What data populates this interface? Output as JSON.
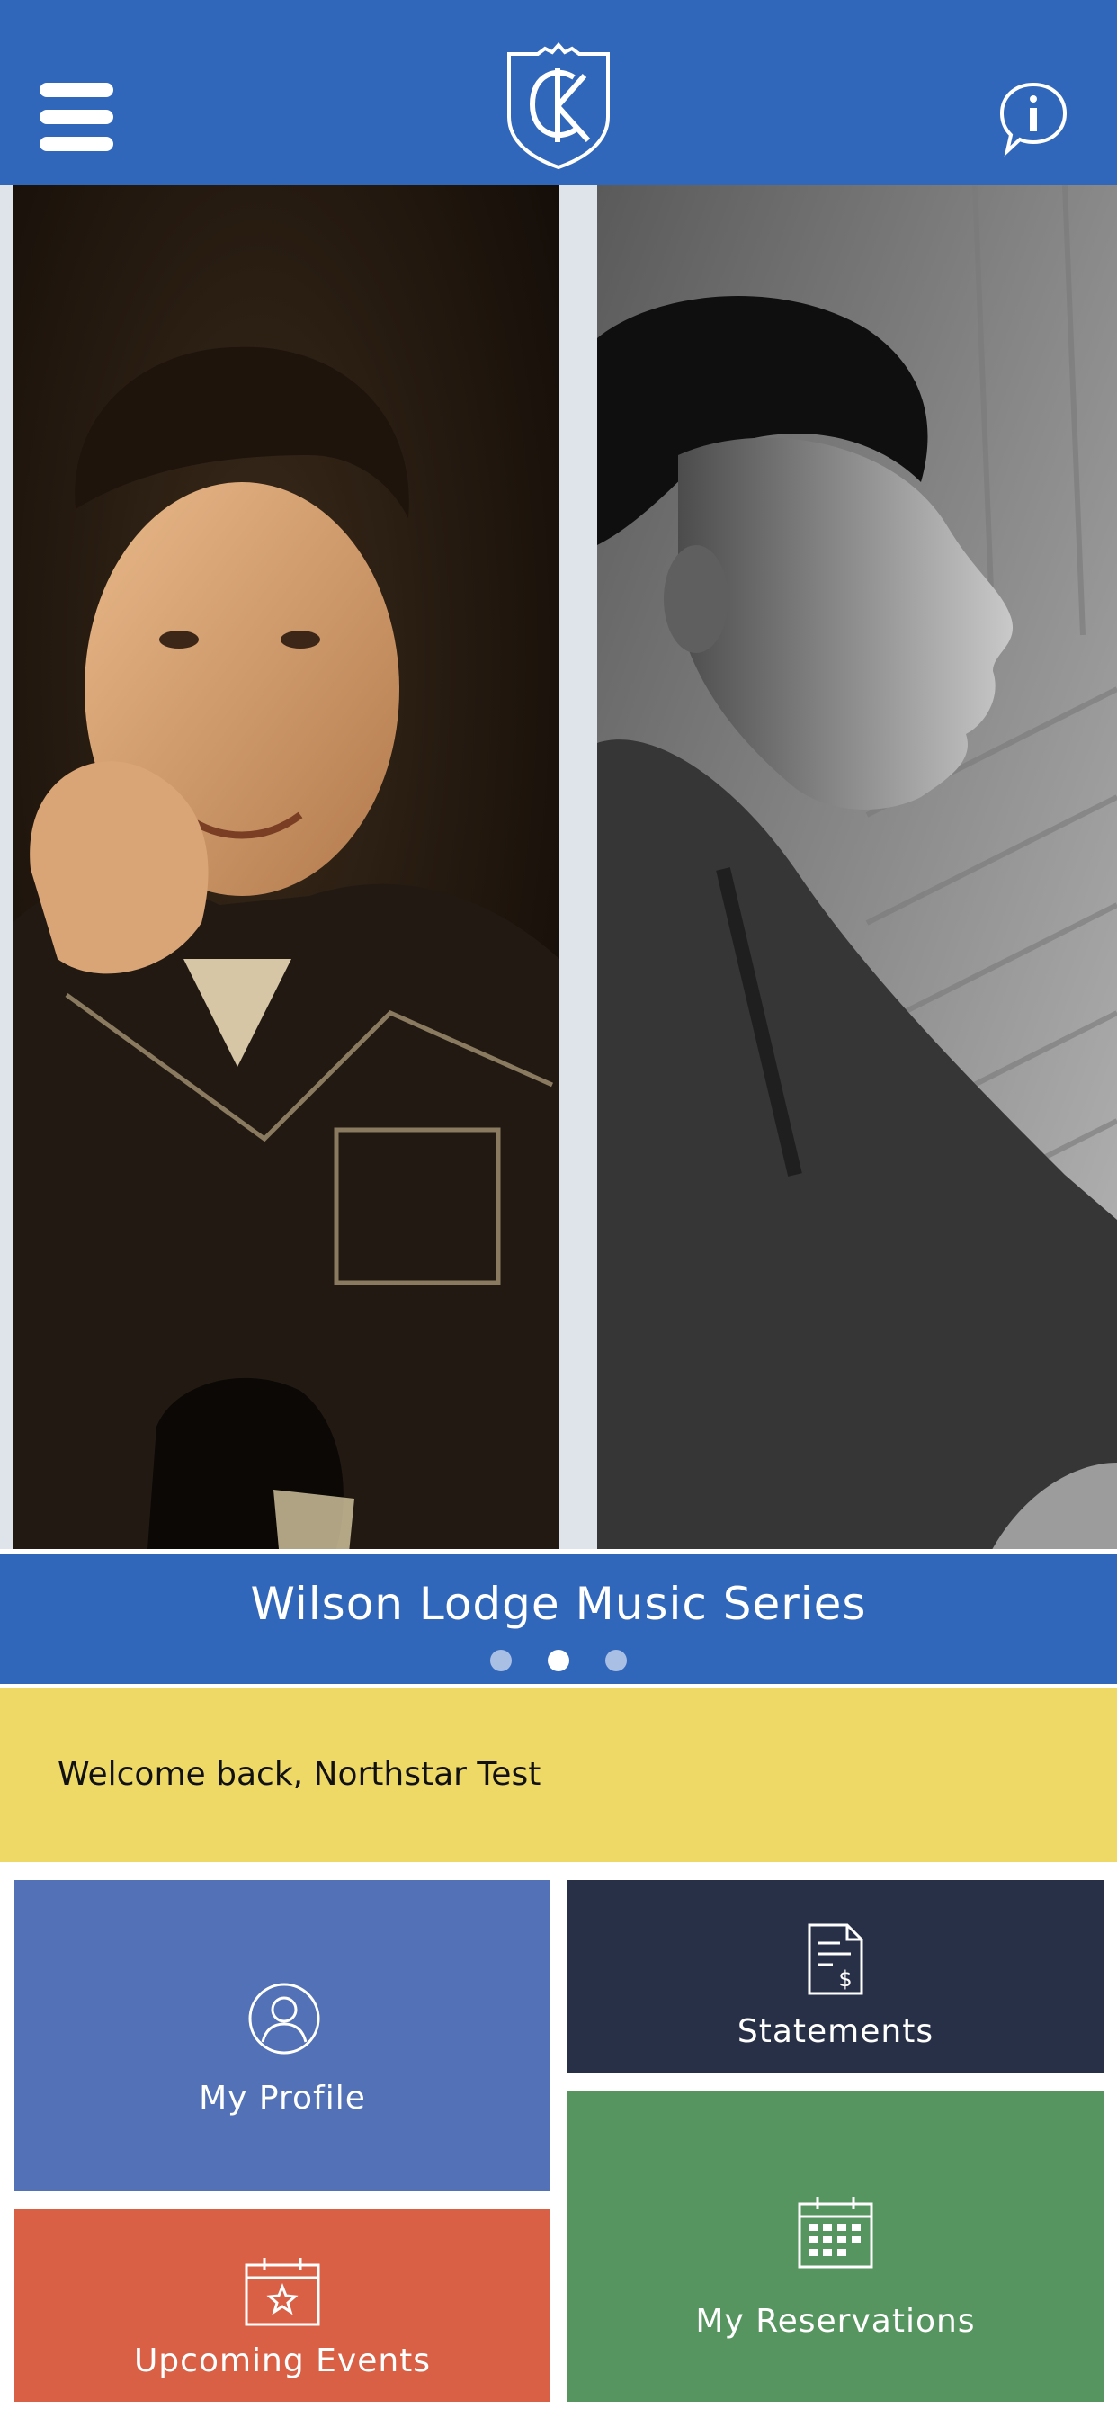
{
  "header": {
    "menu_icon": "hamburger-menu-icon",
    "logo_icon": "crest-logo-icon",
    "info_icon": "info-speech-bubble-icon",
    "color": "#3167bb"
  },
  "carousel": {
    "caption": "Wilson Lodge Music Series",
    "slide_count": 3,
    "active_index": 1
  },
  "welcome": {
    "text": "Welcome back, Northstar Test",
    "color": "#eed866"
  },
  "tiles": [
    {
      "label": "My Profile",
      "icon": "user-profile-icon",
      "color": "#5371b6"
    },
    {
      "label": "Statements",
      "icon": "invoice-document-icon",
      "color": "#283048"
    },
    {
      "label": "Upcoming Events",
      "icon": "calendar-star-icon",
      "color": "#d95f45"
    },
    {
      "label": "My Reservations",
      "icon": "calendar-grid-icon",
      "color": "#56955f"
    }
  ]
}
